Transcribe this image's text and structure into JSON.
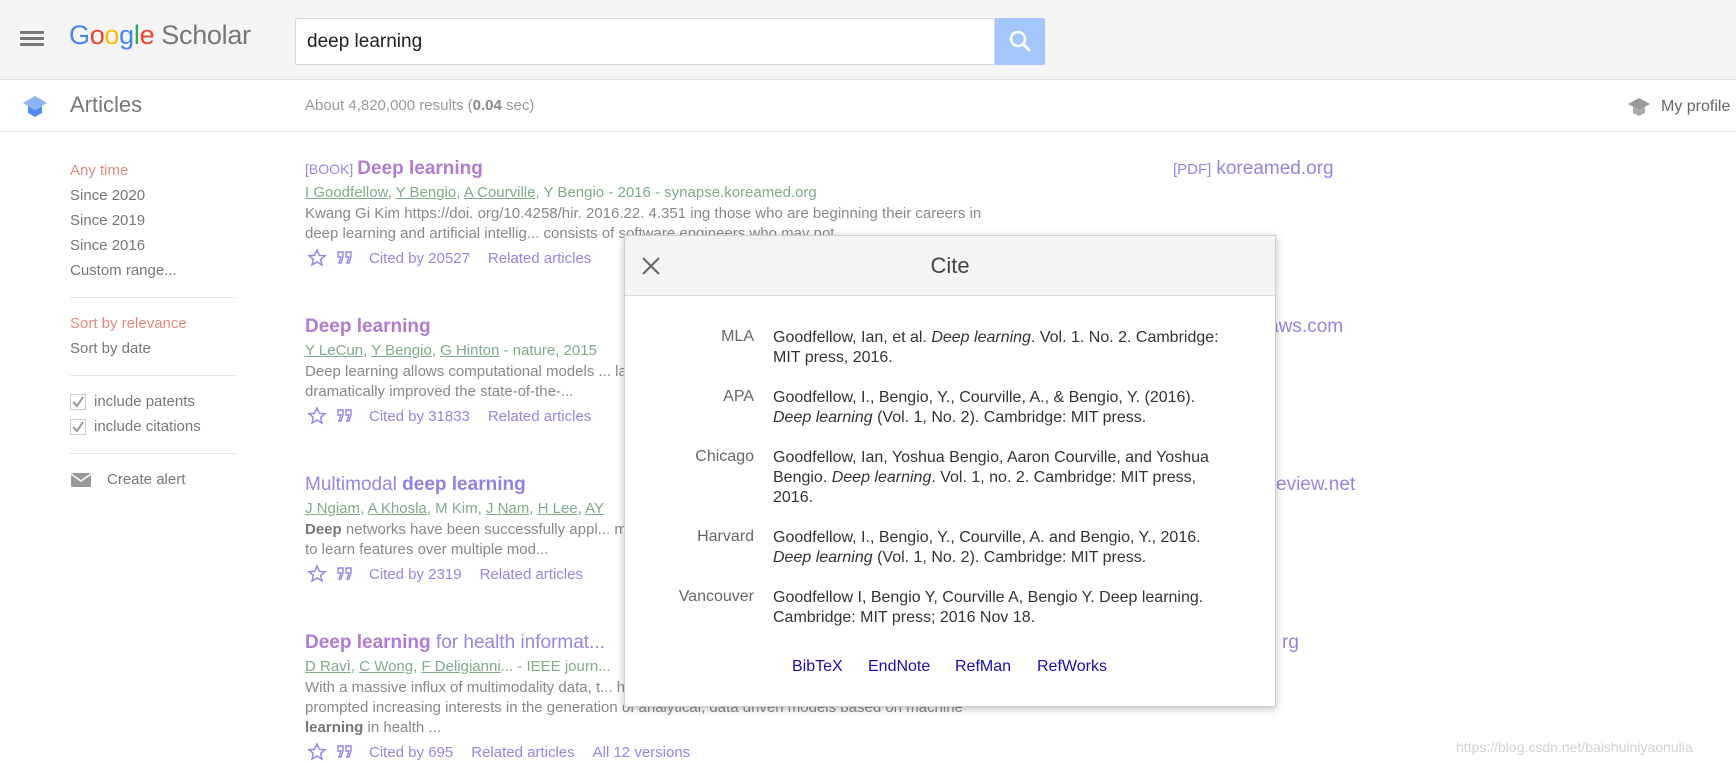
{
  "header": {
    "logo_google": [
      "G",
      "o",
      "o",
      "g",
      "l",
      "e"
    ],
    "logo_scholar": "Scholar",
    "search_value": "deep learning"
  },
  "subbar": {
    "section_title": "Articles",
    "results_prefix": "About 4,820,000 results (",
    "results_time": "0.04",
    "results_suffix": " sec)",
    "my_profile": "My profile"
  },
  "sidebar": {
    "time_filters": [
      "Any time",
      "Since 2020",
      "Since 2019",
      "Since 2016",
      "Custom range..."
    ],
    "sort_options": [
      "Sort by relevance",
      "Sort by date"
    ],
    "include_patents": "include patents",
    "include_citations": "include citations",
    "create_alert": "Create alert"
  },
  "results": [
    {
      "tag": "[BOOK]",
      "title_bold": "Deep learning",
      "title_rest": "",
      "authors": [
        "I Goodfellow",
        "Y Bengio",
        "A Courville"
      ],
      "authors_plain": ", Y Bengio - 2016 - synapse.koreamed.org",
      "snippet": "Kwang Gi Kim https://doi. org/10.4258/hir. 2016.22. 4.351 ing those who are beginning their careers in deep learning and artificial intellig... consists of software engineers who may not",
      "cited_by": "Cited by 20527",
      "related": "Related articles",
      "side_pdf": "[PDF]",
      "side_host": "koreamed.org"
    },
    {
      "tag": "",
      "title_bold": "Deep learning",
      "title_rest": "",
      "authors": [
        "Y LeCun",
        "Y Bengio",
        "G Hinton"
      ],
      "authors_plain": " - nature, 2015",
      "snippet": "Deep learning allows computational models ... layers to learn representations of data with m... have dramatically improved the state-of-the-...",
      "cited_by": "Cited by 31833",
      "related": "Related articles",
      "side_host": "onaws.com"
    },
    {
      "tag": "",
      "title_plain": "Multimodal ",
      "title_bold": "deep learning",
      "authors": [
        "J Ngiam",
        "A Khosla"
      ],
      "authors_mid": ", M Kim, ",
      "authors2": [
        "J Nam",
        "H Lee",
        "AY"
      ],
      "snippet_bold": "Deep",
      "snippet": " networks have been successfully appl... modalities (eg, text, images or audio). In this... networks to learn features over multiple mod...",
      "cited_by": "Cited by 2319",
      "related": "Related articles",
      "side_host": "eview.net"
    },
    {
      "tag": "",
      "title_bold": "Deep learning",
      "title_rest": " for health informat...",
      "authors": [
        "D Ravì",
        "C Wong",
        "F Deligianni"
      ],
      "authors_plain": "... - IEEE journ...",
      "snippet_a": "With a massive influx of multimodality data, t... has grown rapidly in the last decade. This has also prompted increasing interests in the generation of analytical, data driven models based on machine ",
      "snippet_bold": "learning",
      "snippet_b": " in health ...",
      "cited_by": "Cited by 695",
      "related": "Related articles",
      "versions": "All 12 versions",
      "side_host": "rg"
    }
  ],
  "cite_dialog": {
    "title": "Cite",
    "citations": [
      {
        "style": "MLA",
        "pre": "Goodfellow, Ian, et al. ",
        "italic": "Deep learning",
        "post": ". Vol. 1. No. 2. Cambridge: MIT press, 2016."
      },
      {
        "style": "APA",
        "pre": "Goodfellow, I., Bengio, Y., Courville, A., & Bengio, Y. (2016). ",
        "italic": "Deep learning",
        "post": " (Vol. 1, No. 2). Cambridge: MIT press."
      },
      {
        "style": "Chicago",
        "pre": "Goodfellow, Ian, Yoshua Bengio, Aaron Courville, and Yoshua Bengio. ",
        "italic": "Deep learning",
        "post": ". Vol. 1, no. 2. Cambridge: MIT press, 2016."
      },
      {
        "style": "Harvard",
        "pre": "Goodfellow, I., Bengio, Y., Courville, A. and Bengio, Y., 2016. ",
        "italic": "Deep learning",
        "post": " (Vol. 1, No. 2). Cambridge: MIT press."
      },
      {
        "style": "Vancouver",
        "pre": "Goodfellow I, Bengio Y, Courville A, Bengio Y. Deep learning. Cambridge: MIT press; 2016 Nov 18.",
        "italic": "",
        "post": ""
      }
    ],
    "exports": [
      "BibTeX",
      "EndNote",
      "RefMan",
      "RefWorks"
    ]
  },
  "watermark": "https://blog.csdn.net/baishuiniyaonulia",
  "colors": {
    "accent": "#9287e1",
    "author_green": "#7fab86",
    "search_button": "#a3c6fc",
    "active_filter": "#e08a7f"
  },
  "icons": [
    "menu-icon",
    "search-icon",
    "scholar-cap-icon",
    "profile-cap-icon",
    "star-icon",
    "quote-icon",
    "checkbox-icon",
    "mail-icon",
    "close-icon"
  ]
}
